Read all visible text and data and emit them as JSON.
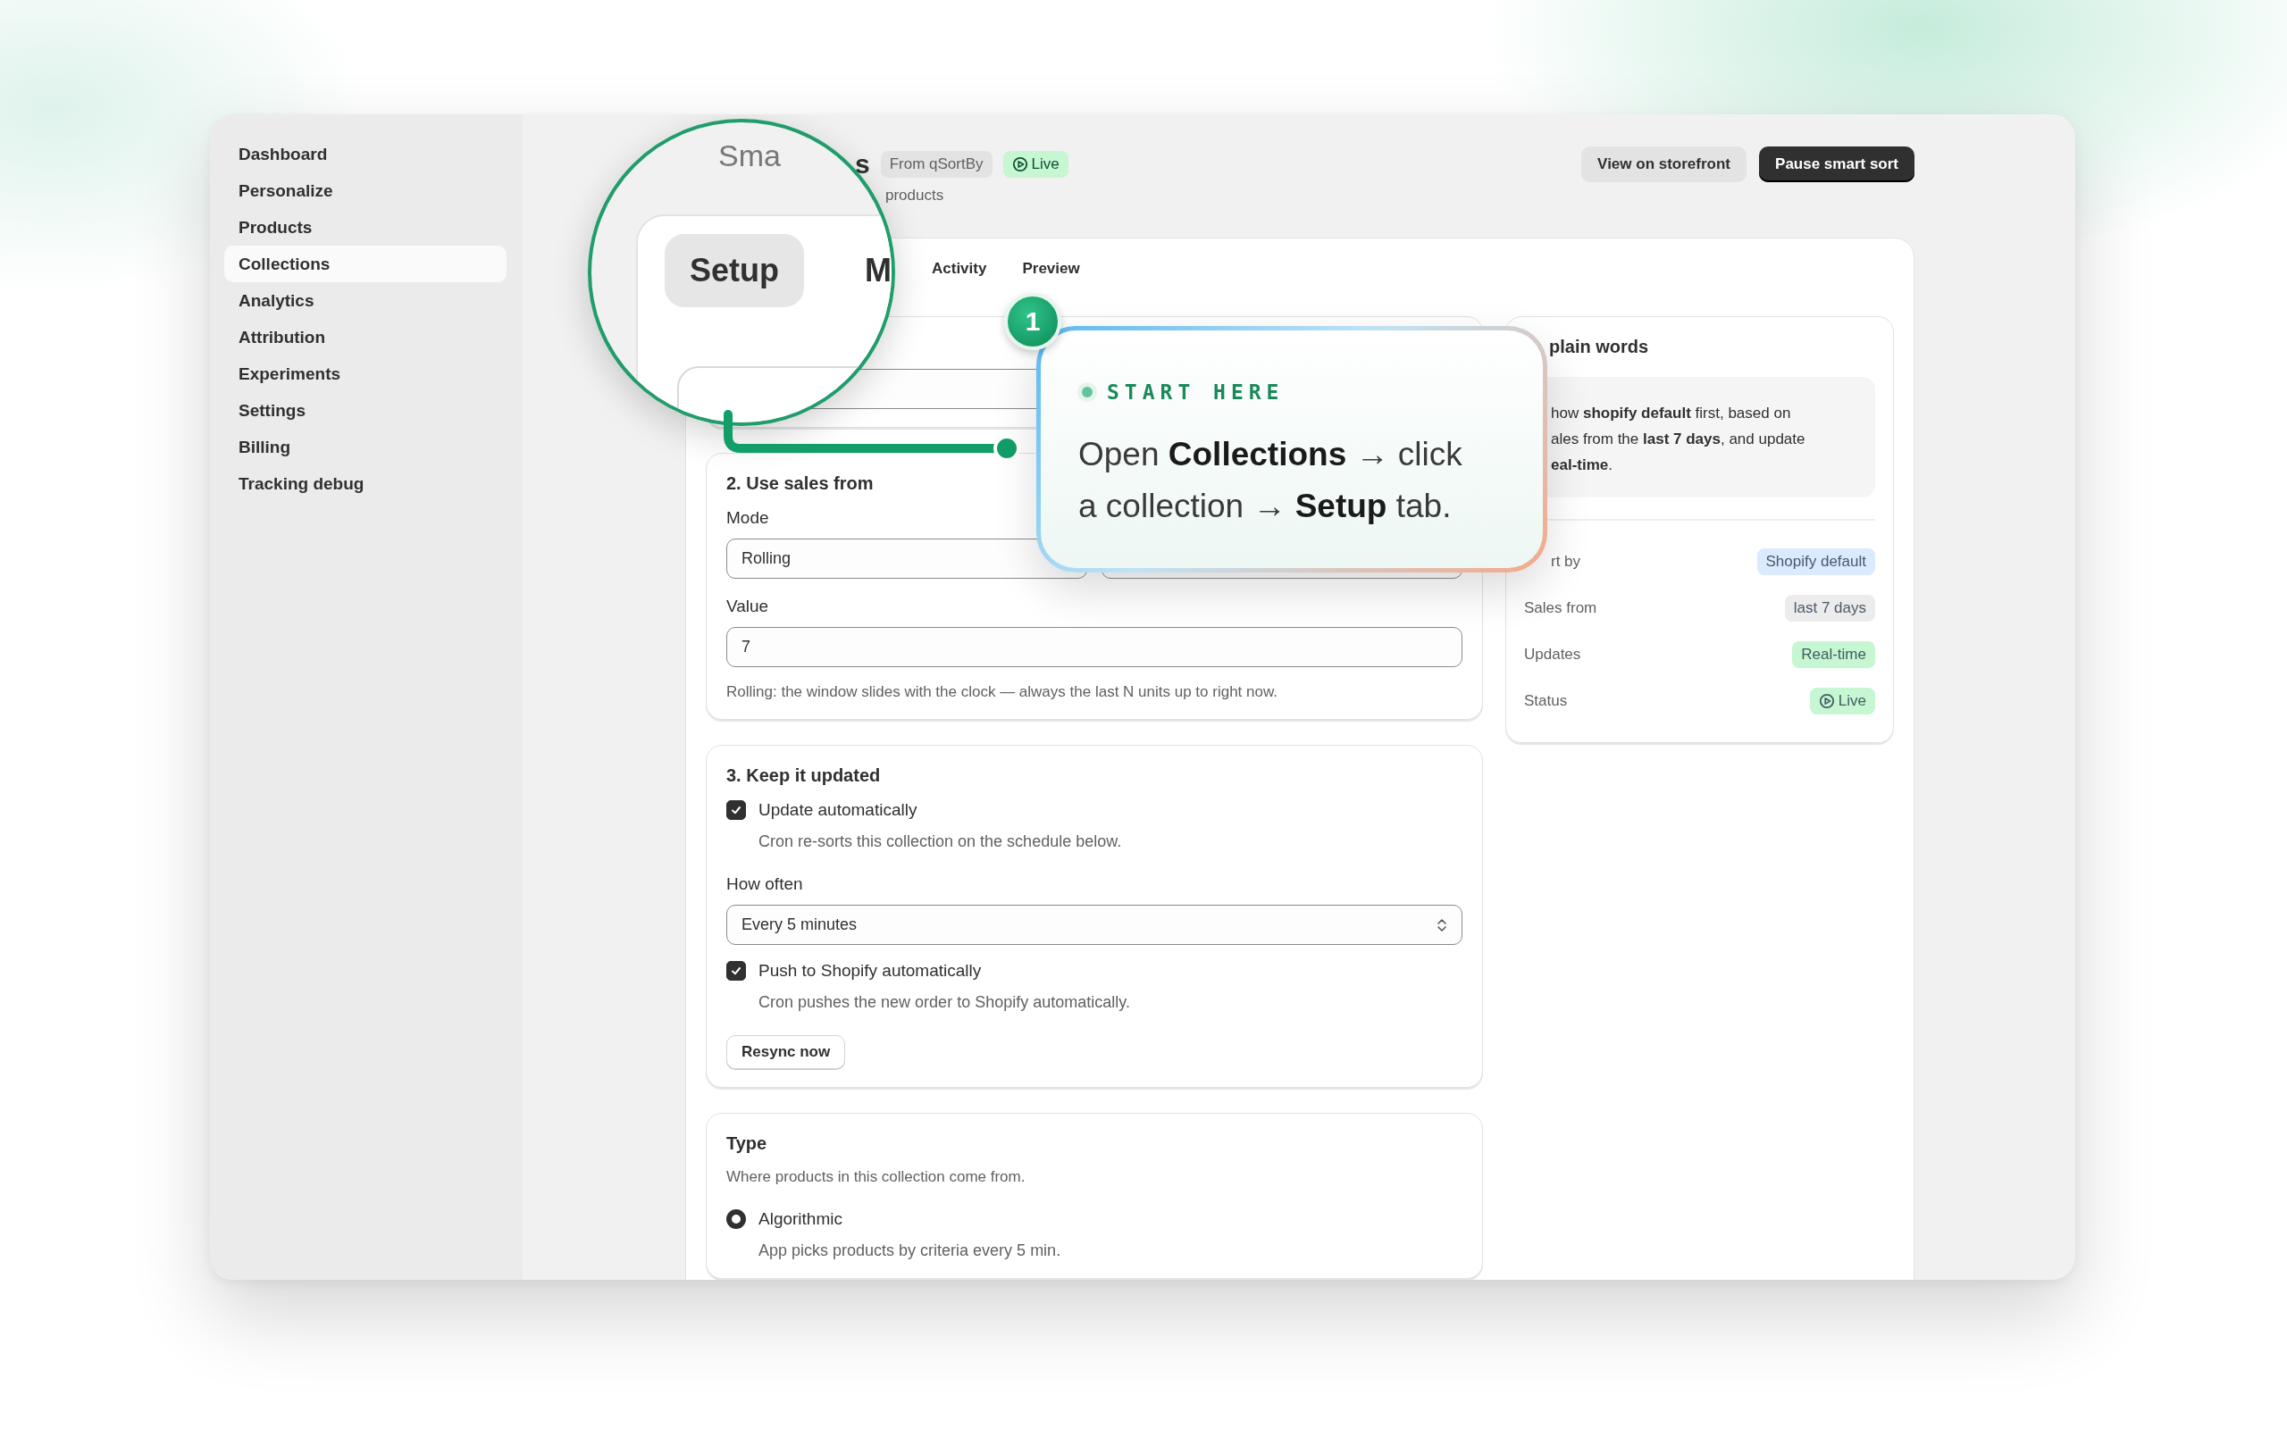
{
  "sidebar": {
    "items": [
      {
        "label": "Dashboard",
        "selected": false
      },
      {
        "label": "Personalize",
        "selected": false
      },
      {
        "label": "Products",
        "selected": false
      },
      {
        "label": "Collections",
        "selected": true
      },
      {
        "label": "Analytics",
        "selected": false
      },
      {
        "label": "Attribution",
        "selected": false
      },
      {
        "label": "Experiments",
        "selected": false
      },
      {
        "label": "Settings",
        "selected": false
      },
      {
        "label": "Billing",
        "selected": false
      },
      {
        "label": "Tracking debug",
        "selected": false
      }
    ]
  },
  "header": {
    "title": "s",
    "badges": [
      {
        "label": "From qSortBy",
        "kind": "source"
      },
      {
        "label": "Live",
        "kind": "live"
      }
    ],
    "subtitle": "products",
    "actions": [
      {
        "label": "View on storefront",
        "kind": "secondary"
      },
      {
        "label": "Pause smart sort",
        "kind": "primary"
      }
    ]
  },
  "tabs": [
    {
      "label": "Activity",
      "selected": false
    },
    {
      "label": "Preview",
      "selected": false
    }
  ],
  "cards": [
    {
      "heading": "2. Use sales from",
      "items": [
        {
          "kind": "split_field",
          "label": "Mode",
          "value": "Rolling"
        },
        {
          "kind": "input",
          "label": "Value",
          "value": "7"
        },
        {
          "kind": "help",
          "text": "Rolling: the window slides with the clock — always the last N units up to right now."
        }
      ]
    },
    {
      "heading": "3. Keep it updated",
      "items": [
        {
          "kind": "checkbox",
          "label": "Update automatically",
          "checked": true,
          "description": "Cron re-sorts this collection on the schedule below."
        },
        {
          "kind": "select",
          "label": "How often",
          "value": "Every 5 minutes"
        },
        {
          "kind": "checkbox",
          "label": "Push to Shopify automatically",
          "checked": true,
          "description": "Cron pushes the new order to Shopify automatically."
        },
        {
          "kind": "button",
          "label": "Resync now"
        }
      ]
    },
    {
      "heading": "Type",
      "items": [
        {
          "kind": "help",
          "text": "Where products in this collection come from."
        },
        {
          "kind": "radio",
          "label": "Algorithmic",
          "selected": true,
          "description": "App picks products by criteria every 5 min."
        }
      ]
    }
  ],
  "summary": {
    "heading": "plain words",
    "text": "how **shopify default** first, based on ales from the **last 7 days**, and update **eal-time**.",
    "rows": [
      {
        "label": "rt by",
        "value": "Shopify default",
        "color": "#dbeafe",
        "kind": "plain"
      },
      {
        "label": "Sales from",
        "value": "last 7 days",
        "color": "#ececec",
        "kind": "plain"
      },
      {
        "label": "Updates",
        "value": "Real-time",
        "color": "#c6f6d2",
        "kind": "plain"
      },
      {
        "label": "Status",
        "value": "Live",
        "color": "#c6f6d2",
        "kind": "live"
      }
    ]
  },
  "lens": {
    "title": "Sma",
    "tabs": [
      {
        "label": "Setup",
        "selected": true
      },
      {
        "label": "M",
        "selected": false
      }
    ]
  },
  "callout": {
    "badge": "1",
    "eyebrow": "START HERE",
    "text": "Open **Collections** → click a collection → **Setup** tab."
  }
}
